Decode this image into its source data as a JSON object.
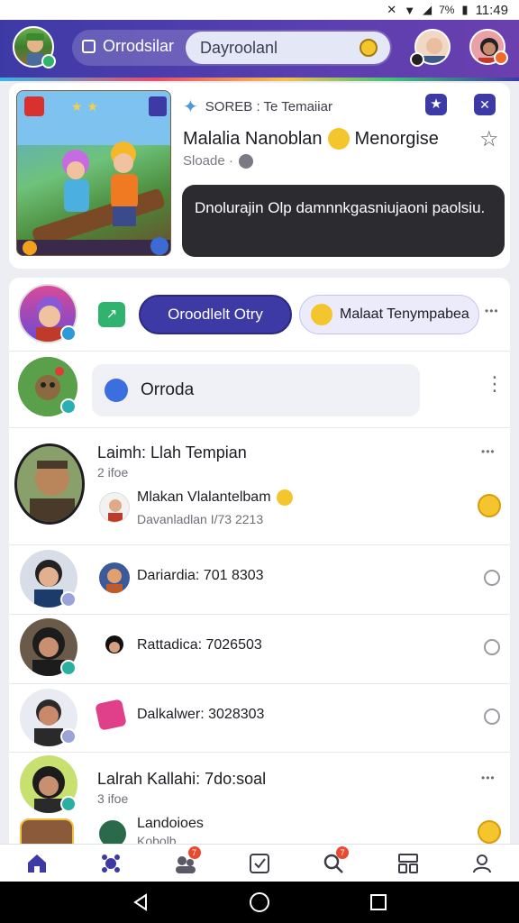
{
  "status_bar": {
    "time": "11:49",
    "battery": "7%"
  },
  "header": {
    "title": "Orrodsilar",
    "search_value": "Dayroolanl"
  },
  "featured": {
    "source": "SOREB : Te Temaiiar",
    "title": "Malalia Nanoblan",
    "title_suffix": "Menorgise",
    "meta": "Sloade ·",
    "bubble_text": "Dnolurajin Olp damnnkgasniujaoni paolsiu.",
    "colors": {
      "bubble": "#2c2c30",
      "accent": "#3d3aa6"
    }
  },
  "composer": {
    "primary_chip": "Oroodlelt Otry",
    "secondary_chip": "Malaat Tenympabea",
    "input_value": "Orroda"
  },
  "feed": [
    {
      "name": "Laimh: Llah Tempian",
      "meta": "2 ifoe",
      "sub_name": "Mlakan Vlalantelbam",
      "sub_meta": "Davanladlan I/73 2213",
      "trailing": "emoji"
    },
    {
      "name": "Dariardia: 701 8303",
      "trailing": "radio"
    },
    {
      "name": "Rattadica: 7026503",
      "trailing": "radio"
    },
    {
      "name": "Dalkalwer: 3028303",
      "trailing": "radio"
    },
    {
      "name": "Lalrah Kallahi: 7do:soal",
      "meta": "3 ifoe",
      "sub_name": "Landoioes",
      "sub_meta": "Kobolb",
      "trailing": "emoji"
    }
  ],
  "bottom_nav": {
    "items": [
      "home-icon",
      "puzzle-icon",
      "people-icon",
      "checkbox-icon",
      "search-icon",
      "dashboard-icon",
      "profile-icon"
    ],
    "badges": {
      "people": "7",
      "search": "7"
    }
  },
  "icons": {
    "more": "•••",
    "kebab": "⋮"
  }
}
